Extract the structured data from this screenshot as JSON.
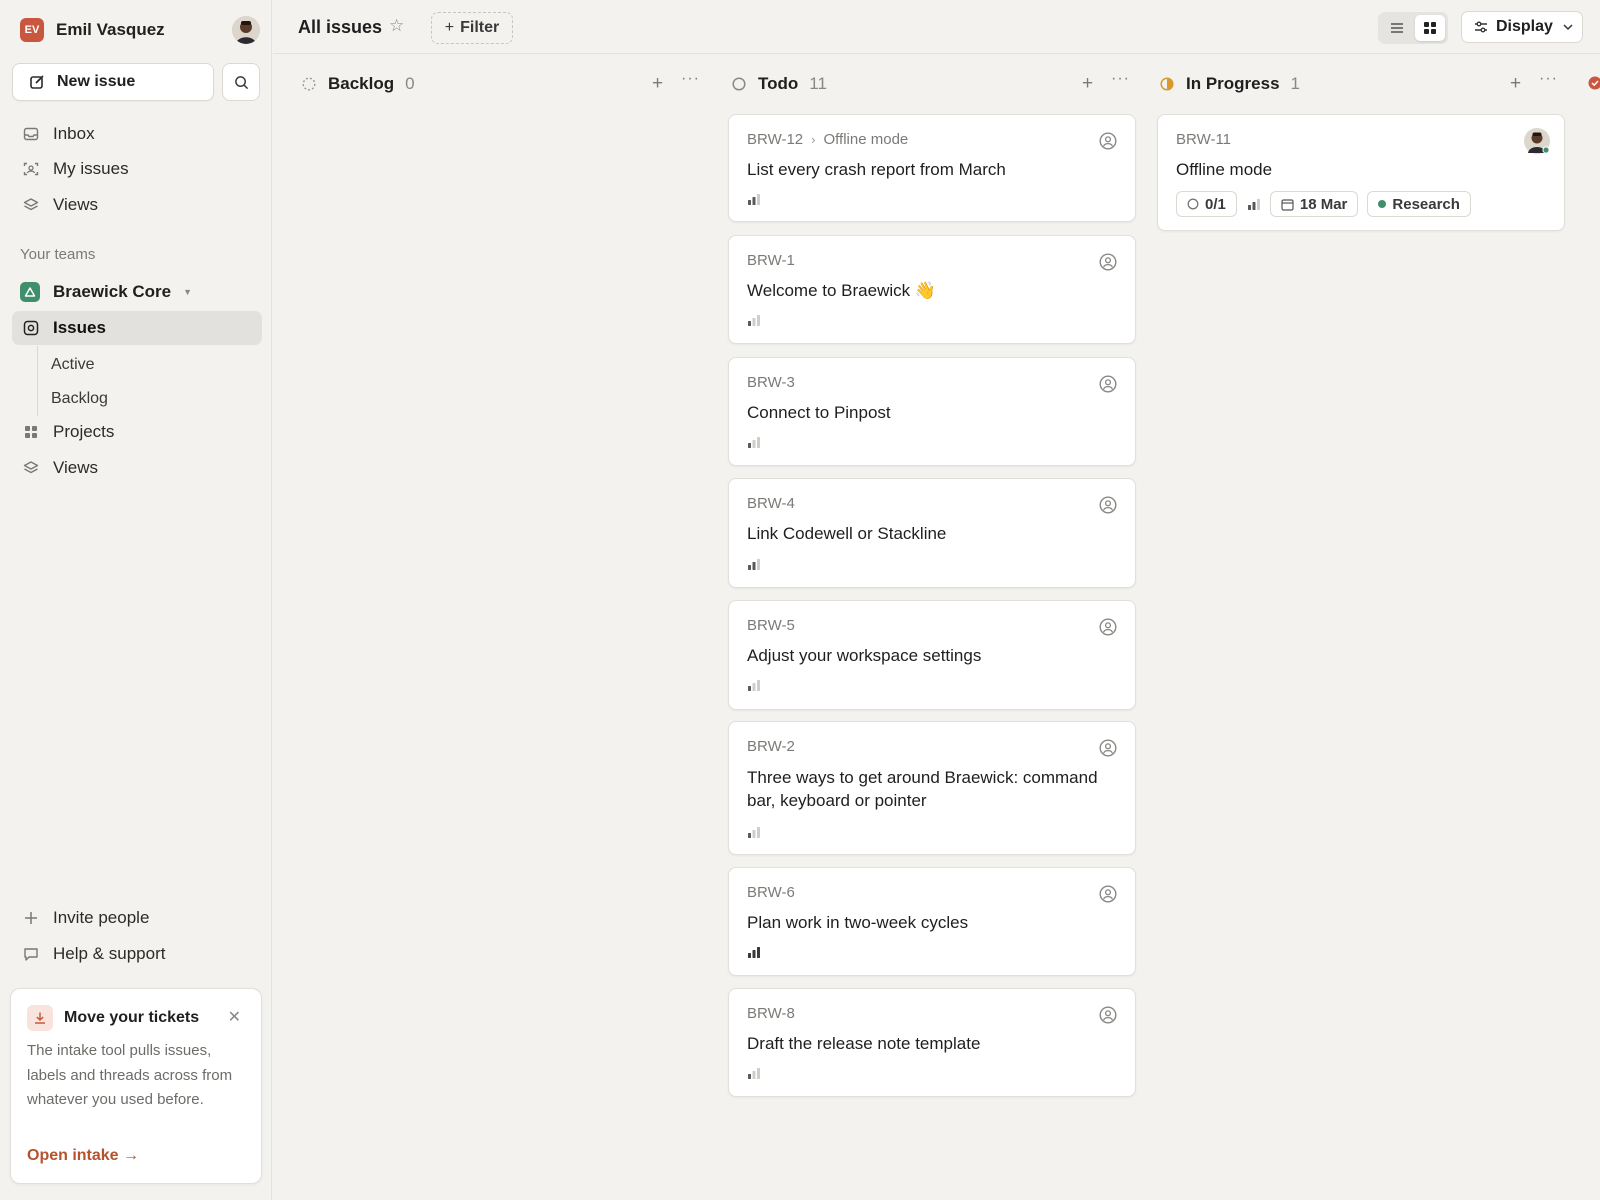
{
  "sidebar": {
    "workspace_initials": "EV",
    "user_name": "Emil Vasquez",
    "new_issue_label": "New issue",
    "nav": [
      {
        "label": "Inbox",
        "icon": "inbox-icon"
      },
      {
        "label": "My issues",
        "icon": "my-issues-icon"
      },
      {
        "label": "Views",
        "icon": "layers-icon"
      }
    ],
    "teams_label": "Your teams",
    "team_name": "Braewick Core",
    "team_nav": {
      "issues": "Issues",
      "active": "Active",
      "backlog": "Backlog",
      "projects": "Projects",
      "views": "Views"
    },
    "invite_label": "Invite people",
    "help_label": "Help & support",
    "promo": {
      "title": "Move your tickets",
      "body": "The intake tool pulls issues, labels and threads across from whatever you used before.",
      "link": "Open intake",
      "link_arrow": "→"
    }
  },
  "header": {
    "title": "All issues",
    "filter_label": "Filter",
    "display_label": "Display"
  },
  "columns": [
    {
      "name": "Backlog",
      "count": "0"
    },
    {
      "name": "Todo",
      "count": "11"
    },
    {
      "name": "In Progress",
      "count": "1"
    }
  ],
  "todo_cards": [
    {
      "id": "BRW-12",
      "parent": "Offline mode",
      "title": "List every crash report from March"
    },
    {
      "id": "BRW-1",
      "title": "Welcome to Braewick 👋"
    },
    {
      "id": "BRW-3",
      "title": "Connect to Pinpost"
    },
    {
      "id": "BRW-4",
      "title": "Link Codewell or Stackline"
    },
    {
      "id": "BRW-5",
      "title": "Adjust your workspace settings"
    },
    {
      "id": "BRW-2",
      "title": "Three ways to get around Braewick: command bar, keyboard or pointer"
    },
    {
      "id": "BRW-6",
      "title": "Plan work in two-week cycles"
    },
    {
      "id": "BRW-8",
      "title": "Draft the release note template"
    }
  ],
  "progress_card": {
    "id": "BRW-11",
    "title": "Offline mode",
    "subtasks": "0/1",
    "due": "18 Mar",
    "label": "Research"
  },
  "colors": {
    "workspace_badge": "#c9573f",
    "team_badge": "#3f8f6c",
    "in_progress": "#d69a2d",
    "accent_link": "#b5532f",
    "label_dot": "#3f8f6c"
  }
}
